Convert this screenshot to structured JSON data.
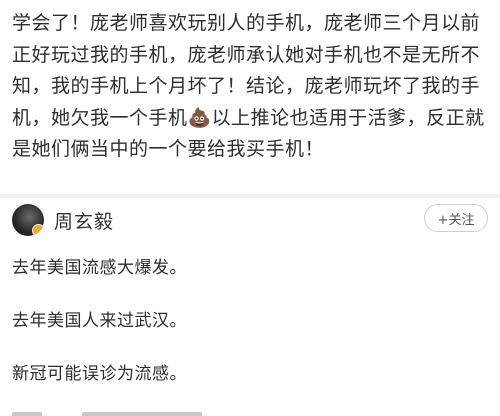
{
  "post": {
    "body": "学会了！庞老师喜欢玩别人的手机，庞老师三个月以前正好玩过我的手机，庞老师承认她对手机也不是无所不知，我的手机上个月坏了！结论，庞老师玩坏了我的手机，她欠我一个手机💩以上推论也适用于活爹，反正就是她们俩当中的一个要给我买手机！"
  },
  "comment": {
    "author_name": "周玄毅",
    "follow_label": "+关注",
    "lines": [
      "去年美国流感大爆发。",
      "去年美国人来过武汉。",
      "新冠可能误诊为流感。"
    ]
  },
  "icons": {
    "avatar": "user-avatar",
    "badge": "verified-badge-icon"
  },
  "colors": {
    "text": "#2e2e2e",
    "divider": "#f1f1f1",
    "badge": "#f5a623",
    "follow_border": "#cfcfcf"
  }
}
